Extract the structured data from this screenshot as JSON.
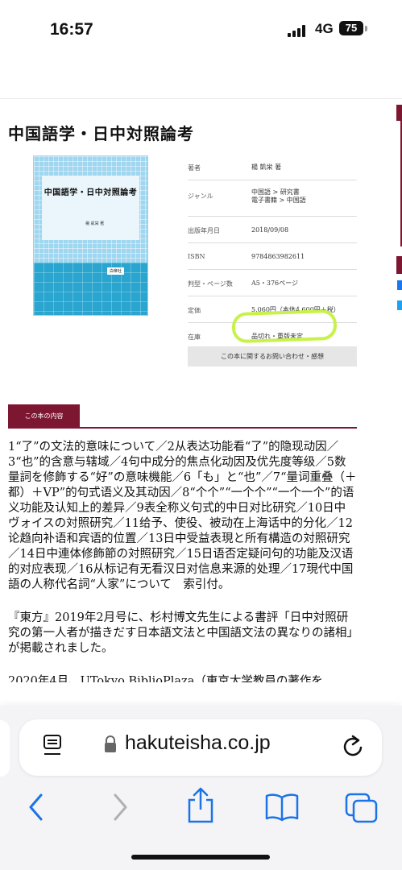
{
  "status_bar": {
    "time": "16:57",
    "network": "4G",
    "battery": "75"
  },
  "page": {
    "title": "中国語学・日中対照論考"
  },
  "cover": {
    "title": "中国語学・日中対照論考",
    "author": "楊 凱栄 著",
    "publisher": "白帝社"
  },
  "specs": [
    {
      "label": "著者",
      "value": "楊 凱栄 著"
    },
    {
      "label": "ジャンル",
      "value": "中国語 > 研究書\n電子書籍 > 中国語"
    },
    {
      "label": "出版年月日",
      "value": "2018/09/08"
    },
    {
      "label": "ISBN",
      "value": "9784863982611"
    },
    {
      "label": "判型・ページ数",
      "value": "A5・376ページ"
    },
    {
      "label": "定価",
      "value": "5,060円（本体4,600円＋税）"
    },
    {
      "label": "在庫",
      "value": "品切れ・重版未定"
    }
  ],
  "inquiry_button": "この本に関するお問い合わせ・感想",
  "content_tab": "この本の内容",
  "content": {
    "toc": "1“了”の文法的意味について／2从表达功能看“了”的隐现动因／3“也”的含意与辖域／4句中成分的焦点化动因及优先度等级／5数量詞を修飾する“好”の意味機能／6「も」と“也”／7“量词重叠（＋都）＋VP”的句式语义及其动因／8“个个”“一个个”“一个一个”的语义功能及认知上的差异／9表全称义句式的中日对比研究／10日中ヴォイスの対照研究／11给予、使役、被动在上海话中的分化／12论趋向补语和宾语的位置／13日中受益表現と所有構造の対照研究／14日中連体修飾節の対照研究／15日语否定疑问句的功能及汉语的对应表现／16从标记有无看汉日对信息来源的处理／17現代中国語の人称代名詞“人家”について　索引付。",
    "review": "『東方』2019年2月号に、杉村博文先生による書評「日中対照研究の第一人者が描きだす日本語文法と中国語文法の異なりの諸相」が掲載されました。",
    "cut_line": "2020年4月、UTokyo BiblioPlaza（東京大学教員の著作を"
  },
  "browser": {
    "url": "hakuteisha.co.jp"
  },
  "colors": {
    "accent": "#7d1630",
    "cover_blue": "#2aa5cf",
    "highlight": "#c8f24a"
  }
}
